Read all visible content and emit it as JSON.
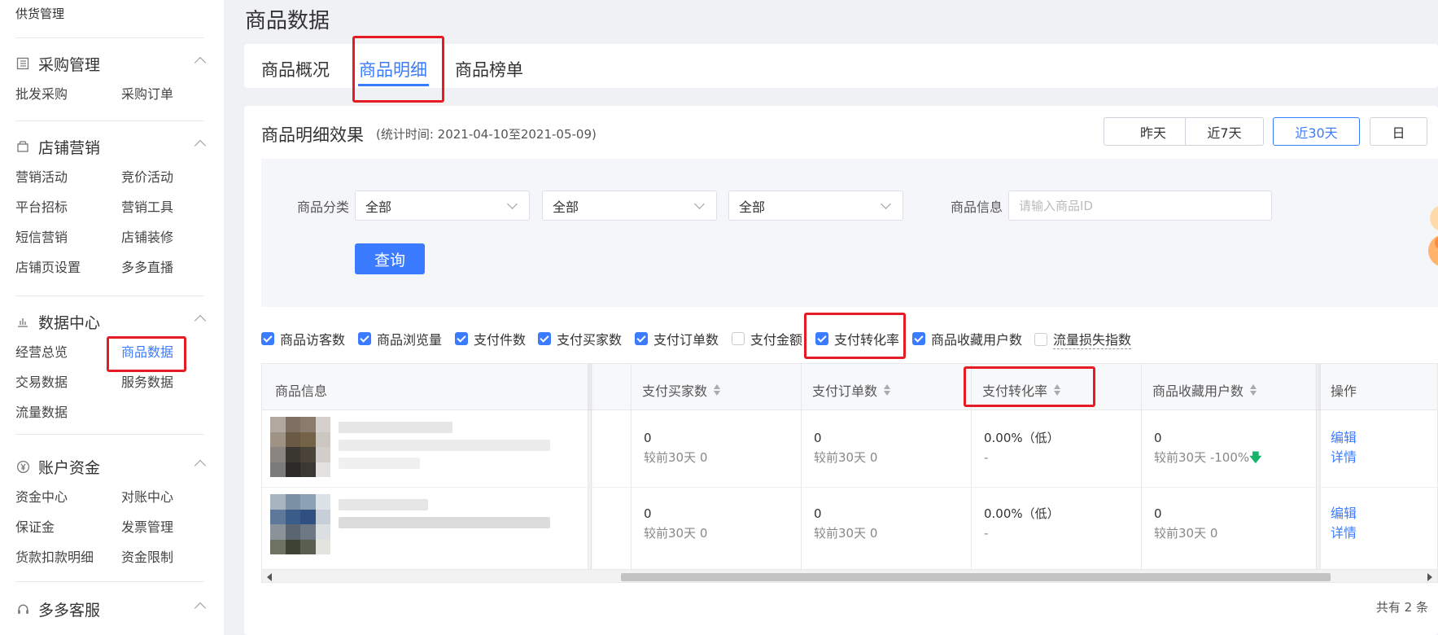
{
  "sidebar": {
    "top_item": "供货管理",
    "groups": [
      {
        "title": "采购管理",
        "icon": "list-icon",
        "items": [
          "批发采购",
          "采购订单"
        ]
      },
      {
        "title": "店铺营销",
        "icon": "shop-icon",
        "items": [
          "营销活动",
          "竞价活动",
          "平台招标",
          "营销工具",
          "短信营销",
          "店铺装修",
          "店铺页设置",
          "多多直播"
        ]
      },
      {
        "title": "数据中心",
        "icon": "bar-chart-icon",
        "items": [
          "经营总览",
          "商品数据",
          "交易数据",
          "服务数据",
          "流量数据"
        ],
        "active": "商品数据"
      },
      {
        "title": "账户资金",
        "icon": "yen-icon",
        "items": [
          "资金中心",
          "对账中心",
          "保证金",
          "发票管理",
          "货款扣款明细",
          "资金限制"
        ]
      },
      {
        "title": "多多客服",
        "icon": "headset-icon",
        "items": []
      }
    ]
  },
  "page_title": "商品数据",
  "tabs": [
    {
      "label": "商品概况",
      "active": false
    },
    {
      "label": "商品明细",
      "active": true
    },
    {
      "label": "商品榜单",
      "active": false
    }
  ],
  "card": {
    "title": "商品明细效果",
    "subtitle": "(统计时间: 2021-04-10至2021-05-09)",
    "date_buttons": [
      {
        "label": "昨天",
        "active": false
      },
      {
        "label": "近7天",
        "active": false
      },
      {
        "label": "近30天",
        "active": true
      },
      {
        "label": "日",
        "active": false
      }
    ]
  },
  "filters": {
    "category_label": "商品分类",
    "category_selects": [
      "全部",
      "全部",
      "全部"
    ],
    "info_label": "商品信息",
    "info_placeholder": "请输入商品ID",
    "query_button": "查询"
  },
  "metrics": [
    {
      "label": "商品访客数",
      "checked": true
    },
    {
      "label": "商品浏览量",
      "checked": true
    },
    {
      "label": "支付件数",
      "checked": true
    },
    {
      "label": "支付买家数",
      "checked": true
    },
    {
      "label": "支付订单数",
      "checked": true
    },
    {
      "label": "支付金额",
      "checked": false
    },
    {
      "label": "支付转化率",
      "checked": true
    },
    {
      "label": "商品收藏用户数",
      "checked": true
    },
    {
      "label": "流量损失指数",
      "checked": false
    }
  ],
  "table": {
    "columns": [
      "商品信息",
      "支付买家数",
      "支付订单数",
      "支付转化率",
      "商品收藏用户数",
      "操作"
    ],
    "rows": [
      {
        "buyers": "0",
        "buyers_cmp": "较前30天 0",
        "orders": "0",
        "orders_cmp": "较前30天 0",
        "conv": "0.00%（低）",
        "conv_cmp": "-",
        "fav": "0",
        "fav_cmp": "较前30天 -100%",
        "fav_trend": "down",
        "actions": [
          "编辑",
          "详情"
        ]
      },
      {
        "buyers": "0",
        "buyers_cmp": "较前30天 0",
        "orders": "0",
        "orders_cmp": "较前30天 0",
        "conv": "0.00%（低）",
        "conv_cmp": "-",
        "fav": "0",
        "fav_cmp": "较前30天 0",
        "fav_trend": "",
        "actions": [
          "编辑",
          "详情"
        ]
      }
    ],
    "total": "共有 2 条"
  },
  "colors": {
    "accent": "#3a7bff",
    "highlight": "#e51c23",
    "down": "#18b36b"
  }
}
